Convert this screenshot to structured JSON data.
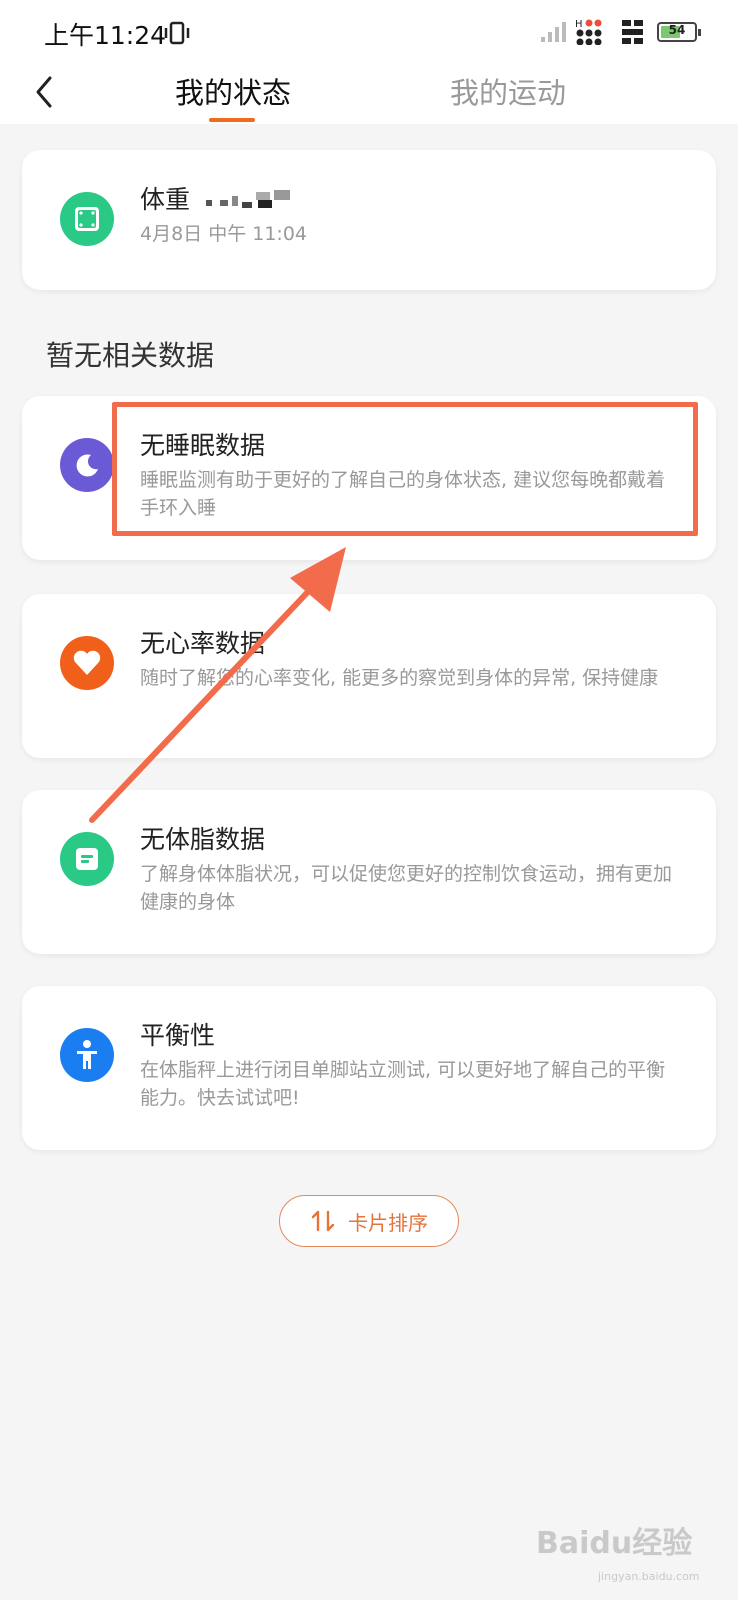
{
  "status_bar": {
    "time": "上午11:24",
    "hd_label": "H",
    "battery": "54"
  },
  "nav": {
    "tabs": [
      {
        "label": "我的状态",
        "active": true
      },
      {
        "label": "我的运动",
        "active": false
      }
    ]
  },
  "weight_card": {
    "title": "体重",
    "date": "4月8日 中午 11:04",
    "icon": "scale-icon",
    "color": "#2bc986"
  },
  "section": {
    "title": "暂无相关数据"
  },
  "cards": [
    {
      "title": "无睡眠数据",
      "desc": "睡眠监测有助于更好的了解自己的身体状态, 建议您每晚都戴着手环入睡",
      "icon": "moon-icon",
      "color": "#6b5ad6"
    },
    {
      "title": "无心率数据",
      "desc": "随时了解您的心率变化, 能更多的察觉到身体的异常, 保持健康",
      "icon": "heart-icon",
      "color": "#f0601a"
    },
    {
      "title": "无体脂数据",
      "desc": "了解身体体脂状况，可以促使您更好的控制饮食运动，拥有更加健康的身体",
      "icon": "body-fat-icon",
      "color": "#2bc986"
    },
    {
      "title": "平衡性",
      "desc": "在体脂秤上进行闭目单脚站立测试, 可以更好地了解自己的平衡能力。快去试试吧!",
      "icon": "person-standing-icon",
      "color": "#1a7ef0"
    }
  ],
  "sort_button": {
    "label": "卡片排序"
  },
  "watermark": {
    "brand": "Baidu经验",
    "url": "jingyan.baidu.com"
  },
  "accent_color": "#f26b1d"
}
